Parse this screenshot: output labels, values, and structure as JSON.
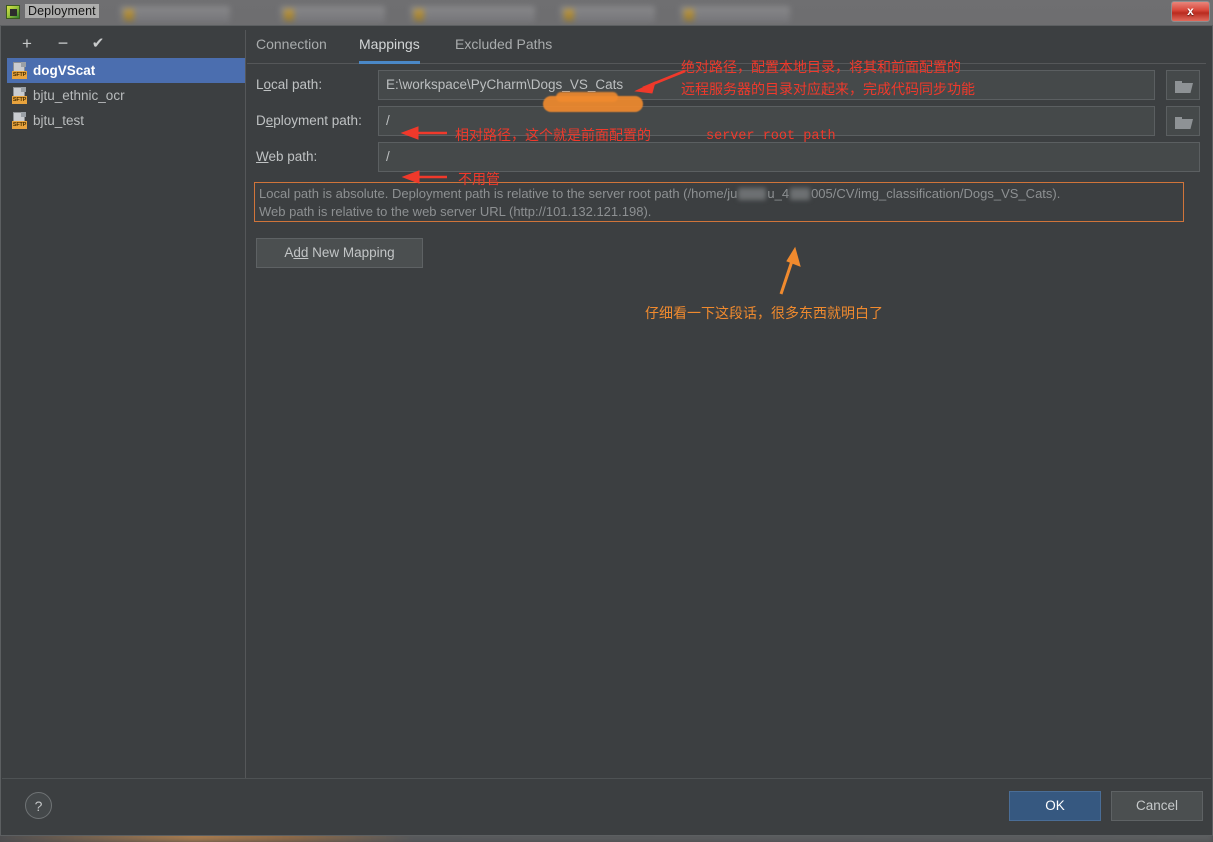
{
  "window": {
    "title": "Deployment",
    "close_label": "x"
  },
  "sidebar": {
    "toolbar": {
      "add_label": "+",
      "remove_label": "−",
      "check_label": "✔"
    },
    "items": [
      {
        "label": "dogVScat",
        "badge": "SFTP",
        "selected": true
      },
      {
        "label": "bjtu_ethnic_ocr",
        "badge": "SFTP",
        "selected": false
      },
      {
        "label": "bjtu_test",
        "badge": "SFTP",
        "selected": false
      }
    ]
  },
  "tabs": [
    {
      "label": "Connection",
      "active": false
    },
    {
      "label": "Mappings",
      "active": true
    },
    {
      "label": "Excluded Paths",
      "active": false
    }
  ],
  "form": {
    "local_path": {
      "label_pre": "L",
      "label_mnemonic": "o",
      "label_post": "cal path:",
      "value": "E:\\workspace\\PyCharm\\Dogs_VS_Cats"
    },
    "deployment_path": {
      "label_pre": "D",
      "label_mnemonic": "e",
      "label_post": "ployment path:",
      "value": "/"
    },
    "web_path": {
      "label_pre": "",
      "label_mnemonic": "W",
      "label_post": "eb path:",
      "value": "/"
    },
    "browse_icon": "folder-icon"
  },
  "info": {
    "line1_a": "Local path is absolute. Deployment path is relative to the server root path (/home/ju",
    "line1_b": "u_4",
    "line1_c": "005/CV/img_classification/Dogs_VS_Cats).",
    "line2": "Web path is relative to the web server URL (http://101.132.121.198)."
  },
  "buttons": {
    "add_mapping_pre": "A",
    "add_mapping_mnemonic": "dd",
    "add_mapping_post": " New Mapping",
    "help": "?",
    "ok": "OK",
    "cancel": "Cancel"
  },
  "annotations": {
    "local_line1": "绝对路径，配置本地目录，将其和前面配置的",
    "local_line2": "远程服务器的目录对应起来，完成代码同步功能",
    "deploy_text": "相对路径，这个就是前面配置的",
    "deploy_mono": "server root path",
    "web_text": "不用管",
    "info_note": "仔细看一下这段话，很多东西就明白了"
  },
  "colors": {
    "dialog_bg": "#3c3f41",
    "selection_blue": "#4b6eaf",
    "tab_underline": "#4a88c7",
    "ok_button": "#365880",
    "info_border": "#d0743a",
    "anno_red": "#f0392b",
    "anno_orange": "#f08a2e",
    "sftp_badge": "#e8a33d"
  }
}
